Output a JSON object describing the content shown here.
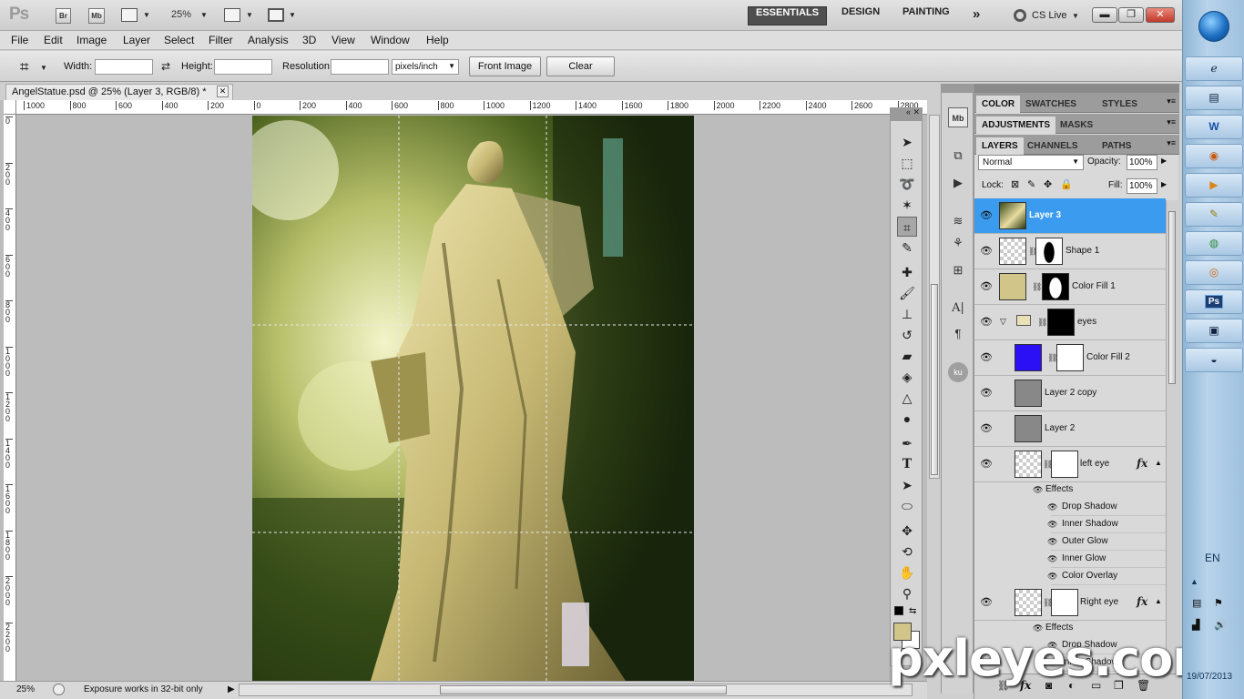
{
  "appbar": {
    "logo": "Ps",
    "bridge_btn": "Br",
    "minibridge_btn": "Mb",
    "zoom": "25%",
    "workspaces": [
      "ESSENTIALS",
      "DESIGN",
      "PAINTING"
    ],
    "more": "»",
    "cslive": "CS Live",
    "win_min": "▬",
    "win_max": "❐",
    "win_close": "✕"
  },
  "menu": [
    "File",
    "Edit",
    "Image",
    "Layer",
    "Select",
    "Filter",
    "Analysis",
    "3D",
    "View",
    "Window",
    "Help"
  ],
  "options": {
    "width_label": "Width:",
    "height_label": "Height:",
    "resolution_label": "Resolution:",
    "units": "pixels/inch",
    "front_image": "Front Image",
    "clear": "Clear"
  },
  "document": {
    "tab_title": "AngelStatue.psd @ 25% (Layer 3, RGB/8) *",
    "hruler_ticks": [
      "1000",
      "800",
      "600",
      "400",
      "200",
      "0",
      "200",
      "400",
      "600",
      "800",
      "1000",
      "1200",
      "1400",
      "1600",
      "1800",
      "2000",
      "2200",
      "2400",
      "2600",
      "2800"
    ],
    "vruler_ticks": [
      "0",
      "2 0 0",
      "4 0 0",
      "6 0 0",
      "8 0 0",
      "1 0 0 0",
      "1 2 0 0",
      "1 4 0 0",
      "1 6 0 0",
      "1 8 0 0",
      "2 0 0 0",
      "2 2 0 0"
    ]
  },
  "status": {
    "zoom": "25%",
    "message": "Exposure works in 32-bit only"
  },
  "panels": {
    "top_tabs": [
      "COLOR",
      "SWATCHES",
      "STYLES"
    ],
    "mid_tabs": [
      "ADJUSTMENTS",
      "MASKS"
    ],
    "layer_tabs": [
      "LAYERS",
      "CHANNELS",
      "PATHS"
    ],
    "blend_mode": "Normal",
    "opacity_label": "Opacity:",
    "opacity": "100%",
    "lock_label": "Lock:",
    "fill_label": "Fill:",
    "fill": "100%",
    "layers": [
      {
        "name": "Layer 3"
      },
      {
        "name": "Shape 1"
      },
      {
        "name": "Color Fill 1"
      },
      {
        "name": "eyes"
      },
      {
        "name": "Color Fill 2"
      },
      {
        "name": "Layer 2 copy"
      },
      {
        "name": "Layer 2"
      },
      {
        "name": "left eye"
      },
      {
        "name": "Right eye"
      }
    ],
    "effects_label": "Effects",
    "left_eye_effects": [
      "Drop Shadow",
      "Inner Shadow",
      "Outer Glow",
      "Inner Glow",
      "Color Overlay"
    ],
    "right_eye_effects": [
      "Drop Shadow",
      "Inner Shadow"
    ],
    "fx": "fx"
  },
  "taskbar": {
    "lang": "EN",
    "date": "19/07/2013",
    "apps": [
      "ie-icon",
      "folder-icon",
      "word-icon",
      "firefox-icon",
      "media-icon",
      "tool-icon",
      "chrome-icon",
      "burn-icon",
      "photoshop-icon",
      "window-icon",
      "paint-icon"
    ],
    "ps_label": "Ps",
    "word_label": "W"
  },
  "watermark": "pxleyes.com",
  "colors": {
    "selected_layer": "#3a9bef",
    "color_fill_1": "#d2c58a",
    "color_fill_2": "#2c10f5",
    "foreground": "#d2c58a"
  }
}
